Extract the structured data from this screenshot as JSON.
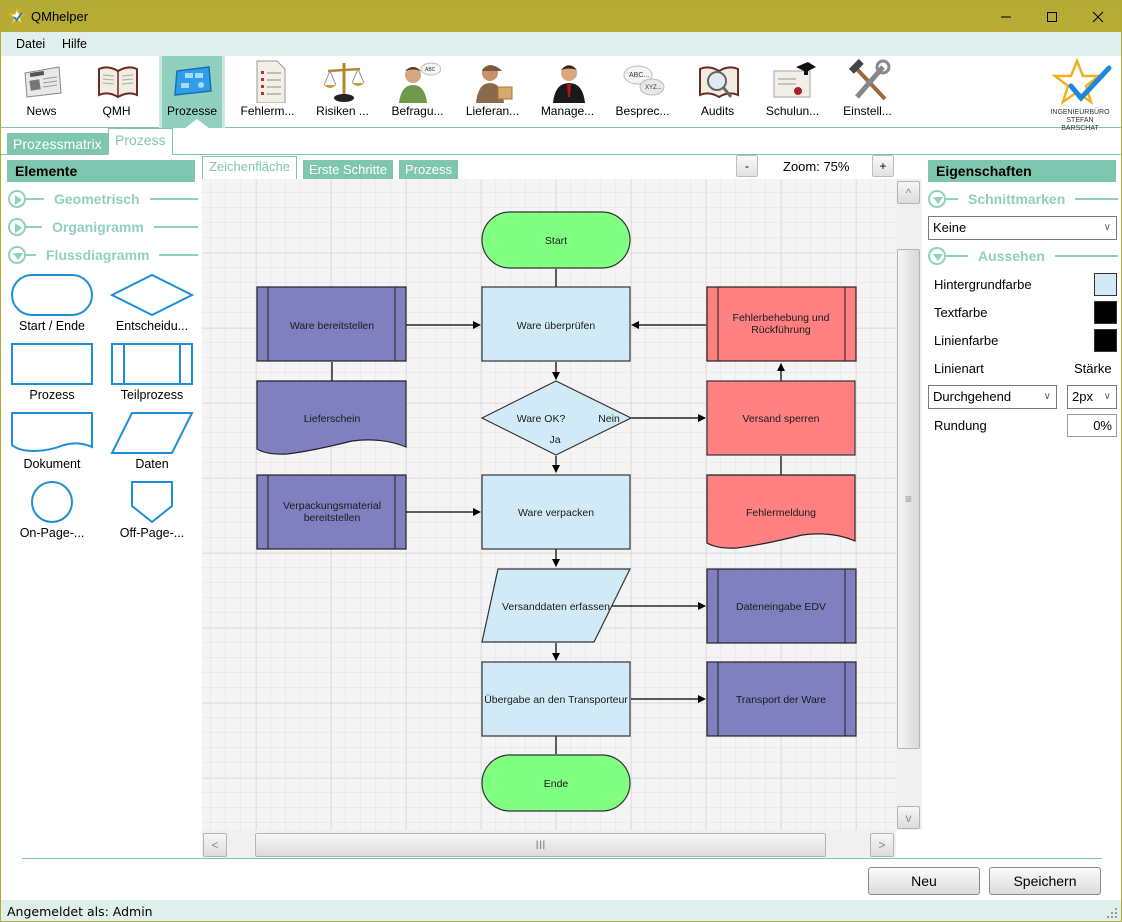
{
  "window": {
    "title": "QMhelper",
    "controls": {
      "minimize": "—",
      "maximize": "☐",
      "close": "✕"
    }
  },
  "menu": {
    "items": [
      "Datei",
      "Hilfe"
    ]
  },
  "ribbon": {
    "items": [
      {
        "label": "News",
        "icon": "newspaper-icon"
      },
      {
        "label": "QMH",
        "icon": "book-icon"
      },
      {
        "label": "Prozesse",
        "icon": "process-map-icon",
        "active": true
      },
      {
        "label": "Fehlerm...",
        "icon": "checklist-icon"
      },
      {
        "label": "Risiken ...",
        "icon": "scales-icon"
      },
      {
        "label": "Befragu...",
        "icon": "person-speech-icon"
      },
      {
        "label": "Lieferan...",
        "icon": "delivery-person-icon"
      },
      {
        "label": "Manage...",
        "icon": "manager-icon"
      },
      {
        "label": "Besprec...",
        "icon": "speech-bubbles-icon"
      },
      {
        "label": "Audits",
        "icon": "book-magnifier-icon"
      },
      {
        "label": "Schulun...",
        "icon": "certificate-icon"
      },
      {
        "label": "Einstell...",
        "icon": "tools-icon"
      }
    ],
    "logo": {
      "line1": "INGENIEURBÜRO",
      "line2": "STEFAN BARSCHAT"
    }
  },
  "top_tabs": [
    {
      "label": "Prozessmatrix",
      "active": false
    },
    {
      "label": "Prozess",
      "active": true
    }
  ],
  "elements_panel": {
    "title": "Elemente",
    "sections": [
      {
        "title": "Geometrisch",
        "expanded": false
      },
      {
        "title": "Organigramm",
        "expanded": false
      },
      {
        "title": "Flussdiagramm",
        "expanded": true
      }
    ],
    "shapes": [
      {
        "label": "Start / Ende"
      },
      {
        "label": "Entscheidu..."
      },
      {
        "label": "Prozess"
      },
      {
        "label": "Teilprozess"
      },
      {
        "label": "Dokument"
      },
      {
        "label": "Daten"
      },
      {
        "label": "On-Page-..."
      },
      {
        "label": "Off-Page-..."
      }
    ]
  },
  "canvas_tabs": [
    {
      "label": "Zeichenfläche",
      "active": true
    },
    {
      "label": "Erste Schritte",
      "active": false
    },
    {
      "label": "Prozess",
      "active": false
    }
  ],
  "zoom": {
    "minus": "-",
    "plus": "+",
    "label": "Zoom: 75%",
    "value_percent": 75
  },
  "flowchart": {
    "colors": {
      "green": "#80ff80",
      "blue": "#d0ebf7",
      "purple": "#8080c0",
      "red": "#ff8080"
    },
    "nodes": {
      "start": "Start",
      "ware_bereitstellen": "Ware bereitstellen",
      "ware_pruefen": "Ware überprüfen",
      "fehlerbehebung_1": "Fehlerbehebung und",
      "fehlerbehebung_2": "Rückführung",
      "lieferschein": "Lieferschein",
      "decision": "Ware OK?",
      "nein": "Nein",
      "ja": "Ja",
      "versand_sperren": "Versand sperren",
      "verpackung_1": "Verpackungsmaterial",
      "verpackung_2": "bereitstellen",
      "ware_verpacken": "Ware verpacken",
      "fehlermeldung": "Fehlermeldung",
      "versanddaten": "Versanddaten erfassen",
      "dateneingabe": "Dateneingabe EDV",
      "uebergabe": "Übergabe an den Transporteur",
      "transport": "Transport der Ware",
      "ende": "Ende"
    }
  },
  "scrollbars": {
    "up": "^",
    "down": "v",
    "left": "<",
    "right": ">",
    "grip_v": "≡",
    "grip_h": "III"
  },
  "properties_panel": {
    "title": "Eigenschaften",
    "sections": [
      {
        "title": "Schnittmarken",
        "expanded": true
      },
      {
        "title": "Aussehen",
        "expanded": true
      }
    ],
    "schnittmarken_value": "Keine",
    "hintergrundfarbe_label": "Hintergrundfarbe",
    "hintergrundfarbe": "#d0ebf7",
    "textfarbe_label": "Textfarbe",
    "textfarbe": "#000000",
    "linienfarbe_label": "Linienfarbe",
    "linienfarbe": "#000000",
    "linienart_label": "Linienart",
    "staerke_label": "Stärke",
    "linienart_value": "Durchgehend",
    "staerke_value": "2px",
    "rundung_label": "Rundung",
    "rundung_value": "0%"
  },
  "buttons": {
    "new": "Neu",
    "save": "Speichern"
  },
  "status": {
    "text": "Angemeldet als: Admin"
  },
  "accent_color": "#7ec6b0"
}
